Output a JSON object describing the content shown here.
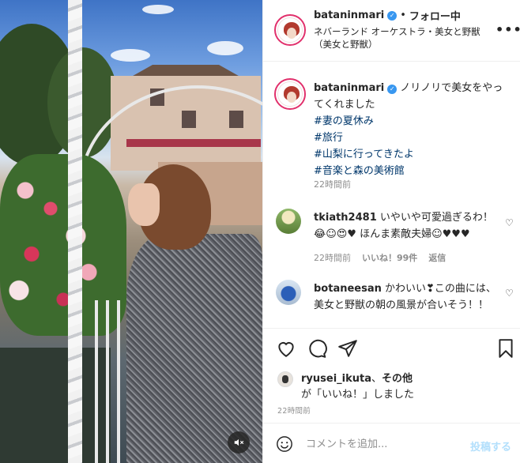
{
  "header": {
    "username": "bataninmari",
    "separator": "•",
    "follow_label": "フォロー中",
    "location": "ネバーランド オーケストラ・美女と野獣（美女と野獣）",
    "more_icon": "more-horizontal-icon"
  },
  "caption": {
    "username": "bataninmari",
    "text": "ノリノリで美女をやってくれました",
    "hashtags": [
      "#妻の夏休み",
      "#旅行",
      "#山梨に行ってきたよ",
      "#音楽と森の美術館"
    ],
    "time": "22時間前"
  },
  "comments": [
    {
      "username": "tkiath2481",
      "text": "いやいや可愛過ぎるわ！😂☺😍♥ ほんま素敵夫婦☺♥♥♥",
      "time": "22時間前",
      "likes": "いいね！99件",
      "reply": "返信"
    },
    {
      "username": "botaneesan",
      "text": "かわいい❣この曲には、美女と野獣の朝の風景が合いそう！！"
    }
  ],
  "actions": {
    "like_icon": "heart-icon",
    "comment_icon": "comment-icon",
    "share_icon": "send-icon",
    "save_icon": "bookmark-icon"
  },
  "liked_by": {
    "username": "ryusei_ikuta",
    "separator": "、",
    "others": "その他",
    "suffix": "が「いいね！」しました"
  },
  "post_time": "22時間前",
  "comment_box": {
    "placeholder": "コメントを追加...",
    "post_label": "投稿する"
  },
  "media": {
    "mute_icon": "speaker-muted-icon"
  }
}
